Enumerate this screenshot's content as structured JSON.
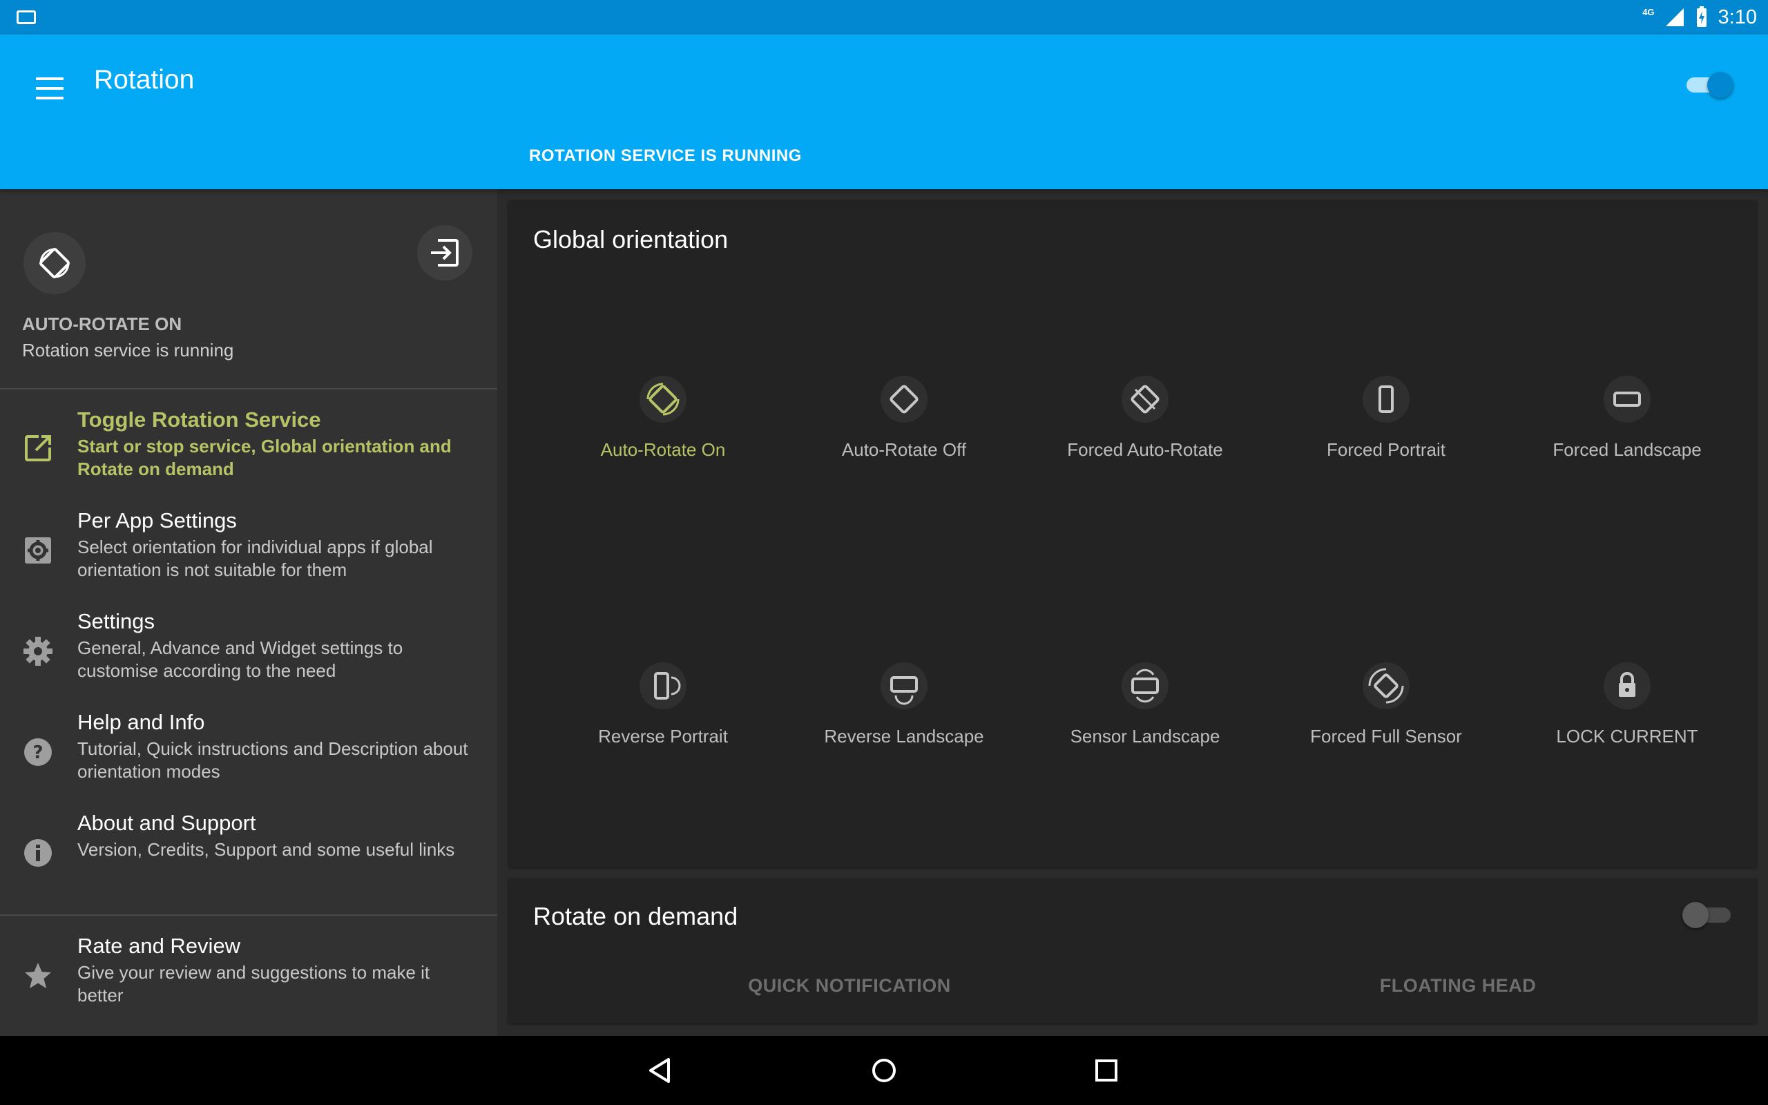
{
  "status_bar": {
    "network": "4G",
    "time": "3:10"
  },
  "app_bar": {
    "title": "Rotation",
    "service_status": "ROTATION SERVICE IS RUNNING",
    "service_enabled": true,
    "accent_color": "#03a9f4"
  },
  "drawer": {
    "current_mode": "AUTO-ROTATE ON",
    "current_sub": "Rotation service is running",
    "items": [
      {
        "title": "Toggle Rotation Service",
        "desc": "Start or stop service, Global orientation and Rotate on demand",
        "icon": "open-in-new-icon",
        "active": true
      },
      {
        "title": "Per App Settings",
        "desc": "Select orientation for individual apps if global orientation is not suitable for them",
        "icon": "app-settings-icon"
      },
      {
        "title": "Settings",
        "desc": "General, Advance and Widget settings to customise according to the need",
        "icon": "gear-icon"
      },
      {
        "title": "Help and Info",
        "desc": "Tutorial, Quick instructions and Description about orientation modes",
        "icon": "help-icon"
      },
      {
        "title": "About and Support",
        "desc": "Version, Credits, Support and some useful links",
        "icon": "info-icon"
      },
      {
        "title": "Rate and Review",
        "desc": "Give your review and suggestions to make it better",
        "icon": "star-icon"
      }
    ],
    "active_color": "#b8c365"
  },
  "global": {
    "title": "Global orientation",
    "options": [
      {
        "label": "Auto-Rotate On",
        "icon": "auto-rotate-on-icon",
        "selected": true
      },
      {
        "label": "Auto-Rotate Off",
        "icon": "auto-rotate-off-icon"
      },
      {
        "label": "Forced Auto-Rotate",
        "icon": "forced-auto-rotate-icon"
      },
      {
        "label": "Forced Portrait",
        "icon": "portrait-icon"
      },
      {
        "label": "Forced Landscape",
        "icon": "landscape-icon"
      },
      {
        "label": "Reverse Portrait",
        "icon": "reverse-portrait-icon"
      },
      {
        "label": "Reverse Landscape",
        "icon": "reverse-landscape-icon"
      },
      {
        "label": "Sensor Landscape",
        "icon": "sensor-landscape-icon"
      },
      {
        "label": "Forced Full Sensor",
        "icon": "full-sensor-icon"
      },
      {
        "label": "LOCK CURRENT",
        "icon": "lock-icon"
      }
    ]
  },
  "demand": {
    "title": "Rotate on demand",
    "enabled": false,
    "quick_notification": "QUICK NOTIFICATION",
    "floating_head": "FLOATING HEAD"
  }
}
